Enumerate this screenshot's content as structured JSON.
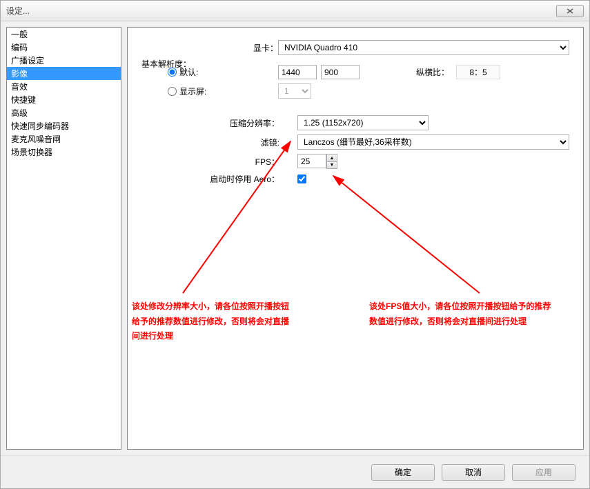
{
  "window": {
    "title": "设定..."
  },
  "sidebar": {
    "items": [
      {
        "label": "一般"
      },
      {
        "label": "编码"
      },
      {
        "label": "广播设定"
      },
      {
        "label": "影像"
      },
      {
        "label": "音效"
      },
      {
        "label": "快捷键"
      },
      {
        "label": "高级"
      },
      {
        "label": "快速同步编码器"
      },
      {
        "label": "麦克风噪音闸"
      },
      {
        "label": "场景切换器"
      }
    ],
    "selected_index": 3
  },
  "labels": {
    "gpu": "显卡：",
    "base_res": "基本解析度：",
    "default": "默认:",
    "monitor": "显示屏:",
    "aspect": "纵横比：",
    "compress": "压缩分辨率：",
    "filter": "滤镜:",
    "fps": "FPS：",
    "aero": "启动时停用 Aero："
  },
  "values": {
    "gpu": "NVIDIA Quadro 410",
    "width": "1440",
    "height": "900",
    "aspect": "8：5",
    "monitor_sel": "1",
    "compress_sel": "1.25  (1152x720)",
    "filter_sel": "Lanczos (细节最好,36采样数)",
    "fps": "25",
    "aero_checked": true
  },
  "annotations": {
    "left": "该处修改分辨率大小，请各位按照开播按钮给予的推荐数值进行修改，否则将会对直播间进行处理",
    "right": "该处FPS值大小，请各位按照开播按钮给予的推荐数值进行修改，否则将会对直播间进行处理"
  },
  "footer": {
    "ok": "确定",
    "cancel": "取消",
    "apply": "应用"
  }
}
